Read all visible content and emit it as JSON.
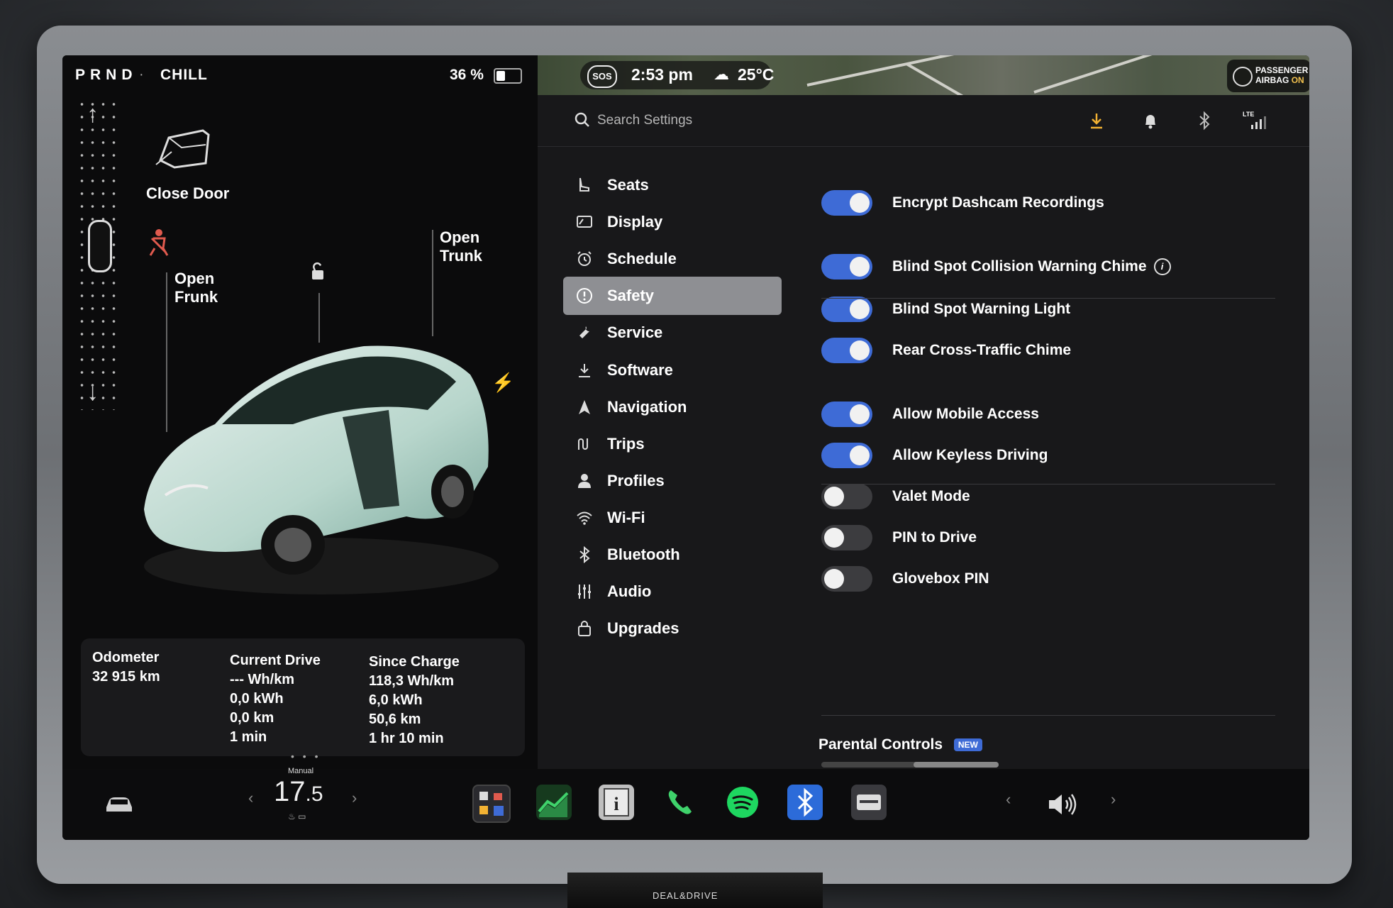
{
  "status_bar": {
    "gear": "PRND",
    "separator": "·",
    "drive_mode": "CHILL",
    "battery_percent": "36 %",
    "battery_level": 0.36,
    "sos": "SOS",
    "time": "2:53 pm",
    "temperature": "25°C",
    "airbag_line1": "PASSENGER",
    "airbag_line2_prefix": "AIRBAG",
    "airbag_line2_state": "ON"
  },
  "car_panel": {
    "close_door": "Close Door",
    "open_frunk_line1": "Open",
    "open_frunk_line2": "Frunk",
    "open_trunk_line1": "Open",
    "open_trunk_line2": "Trunk"
  },
  "stats": {
    "odometer": {
      "title": "Odometer",
      "lines": [
        "32 915 km"
      ]
    },
    "current_drive": {
      "title": "Current Drive",
      "lines": [
        "--- Wh/km",
        "0,0 kWh",
        "0,0 km",
        "1 min"
      ]
    },
    "since_charge": {
      "title": "Since Charge",
      "lines": [
        "118,3 Wh/km",
        "6,0 kWh",
        "50,6 km",
        "1 hr 10 min"
      ]
    }
  },
  "search": {
    "placeholder": "Search Settings"
  },
  "top_icons": {
    "network": "LTE"
  },
  "nav": [
    {
      "label": "Seats",
      "icon": "seat-icon"
    },
    {
      "label": "Display",
      "icon": "display-icon"
    },
    {
      "label": "Schedule",
      "icon": "alarm-clock-icon"
    },
    {
      "label": "Safety",
      "icon": "alert-circle-icon",
      "active": true
    },
    {
      "label": "Service",
      "icon": "wrench-icon"
    },
    {
      "label": "Software",
      "icon": "download-icon"
    },
    {
      "label": "Navigation",
      "icon": "navigation-arrow-icon"
    },
    {
      "label": "Trips",
      "icon": "trips-icon"
    },
    {
      "label": "Profiles",
      "icon": "person-icon"
    },
    {
      "label": "Wi-Fi",
      "icon": "wifi-icon"
    },
    {
      "label": "Bluetooth",
      "icon": "bluetooth-icon"
    },
    {
      "label": "Audio",
      "icon": "sliders-icon"
    },
    {
      "label": "Upgrades",
      "icon": "shopping-bag-icon"
    }
  ],
  "options": [
    {
      "label": "Encrypt Dashcam Recordings",
      "on": true
    },
    {
      "label": "Blind Spot Collision Warning Chime",
      "on": true,
      "info": true
    },
    {
      "label": "Blind Spot Warning Light",
      "on": true
    },
    {
      "label": "Rear Cross-Traffic Chime",
      "on": true
    },
    {
      "label": "Allow Mobile Access",
      "on": true
    },
    {
      "label": "Allow Keyless Driving",
      "on": true
    },
    {
      "label": "Valet Mode",
      "on": false
    },
    {
      "label": "PIN to Drive",
      "on": false
    },
    {
      "label": "Glovebox PIN",
      "on": false
    }
  ],
  "parental": {
    "label": "Parental Controls",
    "badge": "NEW"
  },
  "dock": {
    "climate_mode": "Manual",
    "climate_temp_int": "17",
    "climate_temp_dec": ".5",
    "page_dots": "• • •",
    "chevron_left": "‹",
    "chevron_right": "›",
    "apps": [
      "toybox-icon",
      "stocks-icon",
      "manual-icon",
      "phone-icon",
      "spotify-icon",
      "bluetooth-app-icon",
      "dashcam-icon"
    ]
  },
  "brand": "DEAL&DRIVE",
  "colors": {
    "accent": "#3e6bd6",
    "active_nav": "#8e8f93",
    "warning": "#e05a4e",
    "download": "#f2b233"
  }
}
